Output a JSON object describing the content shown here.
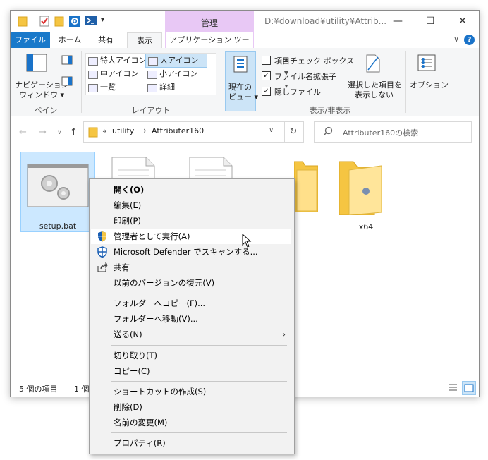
{
  "titlebar": {
    "manage_label": "管理",
    "path": "D:¥download¥utility¥Attrib...",
    "minimize": "—",
    "maximize": "☐",
    "close": "✕"
  },
  "ribbon_tabs": {
    "file": "ファイル",
    "home": "ホーム",
    "share": "共有",
    "view": "表示",
    "app_tools": "アプリケーション ツール",
    "collapse": "∨",
    "help": "?"
  },
  "ribbon": {
    "pane": {
      "nav_pane_line1": "ナビゲーション",
      "nav_pane_line2": "ウィンドウ ▾",
      "group_label": "ペイン"
    },
    "layout": {
      "items": [
        "特大アイコン",
        "大アイコン",
        "中アイコン",
        "小アイコン",
        "一覧",
        "詳細"
      ],
      "selected": "大アイコン",
      "group_label": "レイアウト"
    },
    "current_view": {
      "line1": "現在の",
      "line2": "ビュー ▾"
    },
    "show_hide": {
      "item_checkbox": "項目チェック ボックス",
      "extensions": "ファイル名拡張子",
      "hidden": "隠しファイル",
      "hide_selected_line1": "選択した項目を",
      "hide_selected_line2": "表示しない",
      "group_label": "表示/非表示"
    },
    "options": "オプション"
  },
  "address": {
    "prefix": "«",
    "crumb1": "utility",
    "crumb_sep": "›",
    "crumb2": "Attributer160",
    "search_placeholder": "Attributer160の検索"
  },
  "files": {
    "setup": "setup.bat",
    "x64": "x64"
  },
  "status": {
    "count": "5 個の項目",
    "selected": "1 個"
  },
  "context_menu": {
    "open": "開く(O)",
    "edit": "編集(E)",
    "print": "印刷(P)",
    "run_as_admin": "管理者として実行(A)",
    "defender": "Microsoft Defender でスキャンする...",
    "share": "共有",
    "restore": "以前のバージョンの復元(V)",
    "copy_to": "フォルダーへコピー(F)...",
    "move_to": "フォルダーへ移動(V)...",
    "send_to": "送る(N)",
    "cut": "切り取り(T)",
    "copy": "コピー(C)",
    "shortcut": "ショートカットの作成(S)",
    "delete": "削除(D)",
    "rename": "名前の変更(M)",
    "properties": "プロパティ(R)"
  }
}
